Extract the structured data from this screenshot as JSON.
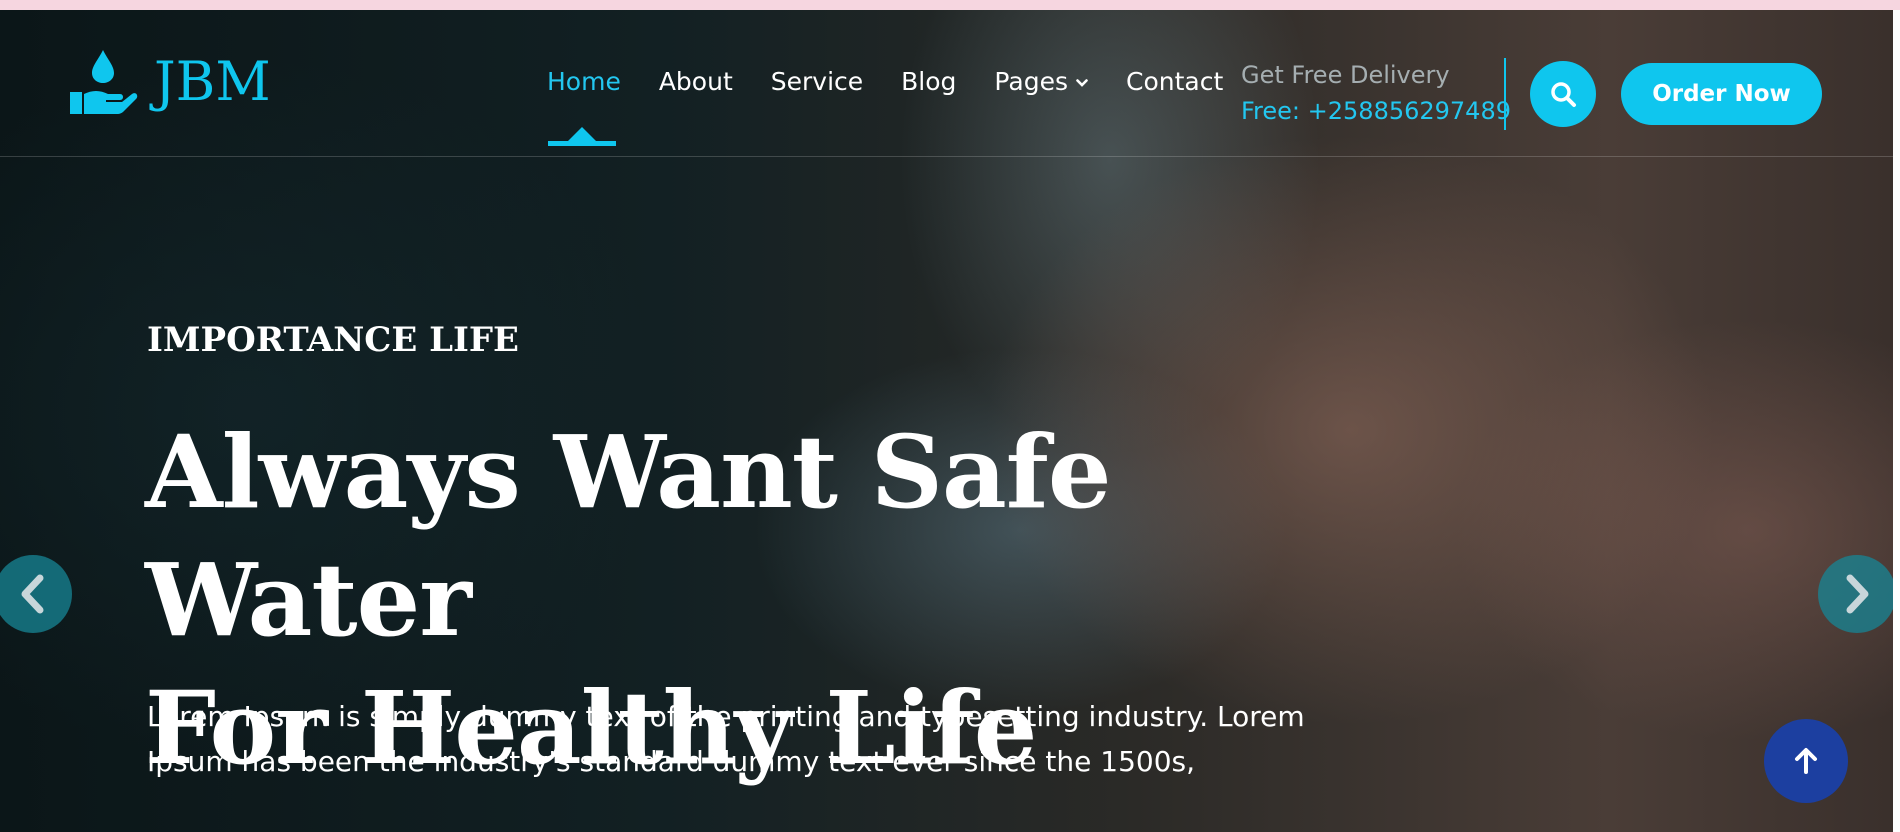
{
  "brand": {
    "name": "JBM",
    "icon": "hand-water-drop-icon",
    "color": "#0fc6ee"
  },
  "nav": {
    "items": [
      {
        "label": "Home",
        "active": true
      },
      {
        "label": "About"
      },
      {
        "label": "Service"
      },
      {
        "label": "Blog"
      },
      {
        "label": "Pages",
        "has_dropdown": true
      },
      {
        "label": "Contact"
      }
    ]
  },
  "delivery": {
    "title": "Get Free Delivery",
    "phone": "Free: +258856297489"
  },
  "actions": {
    "search_icon": "search-icon",
    "order_label": "Order Now"
  },
  "hero": {
    "kicker": "IMPORTANCE LIFE",
    "headline_line1": "Always Want Safe Water",
    "headline_line2": "For Healthy Life",
    "paragraph_line1": "Lorem Ipsum is simply dummy text of the printing and typesetting industry. Lorem",
    "paragraph_line2": "Ipsum has been the industry's standard dummy text ever since the 1500s,"
  },
  "slider": {
    "prev_icon": "chevron-left-icon",
    "next_icon": "chevron-right-icon"
  },
  "scroll_top": {
    "icon": "arrow-up-icon",
    "color": "#1c3fa0"
  },
  "colors": {
    "accent": "#0fc6ee",
    "muted_text": "#a5aeb1"
  }
}
